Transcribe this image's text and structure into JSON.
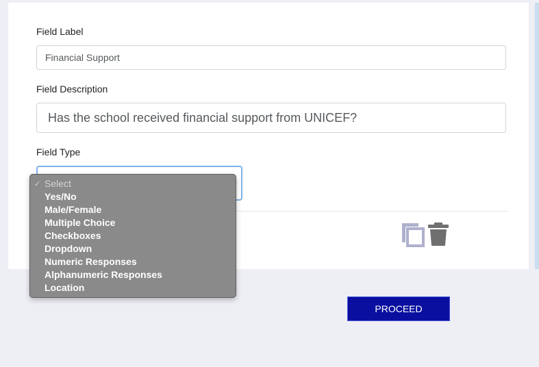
{
  "form": {
    "field_label": {
      "label": "Field Label",
      "value": "Financial Support"
    },
    "field_description": {
      "label": "Field Description",
      "value": "Has the school received financial support from UNICEF?"
    },
    "field_type": {
      "label": "Field Type",
      "selected": "Select",
      "options": [
        "Select",
        "Yes/No",
        "Male/Female",
        "Multiple Choice",
        "Checkboxes",
        "Dropdown",
        "Numeric Responses",
        "Alphanumeric Responses",
        "Location"
      ]
    },
    "actions": {
      "duplicate_icon": "copy-icon",
      "delete_icon": "trash-icon"
    }
  },
  "footer": {
    "proceed_label": "PROCEED"
  },
  "colors": {
    "primary_button": "#0a0fa0",
    "focus_border": "#7fb2e8",
    "dropdown_bg": "#8a8a8a",
    "icon_copy": "#aeb0cc",
    "icon_trash": "#6f6f6f",
    "page_bg": "#eeeef5"
  }
}
